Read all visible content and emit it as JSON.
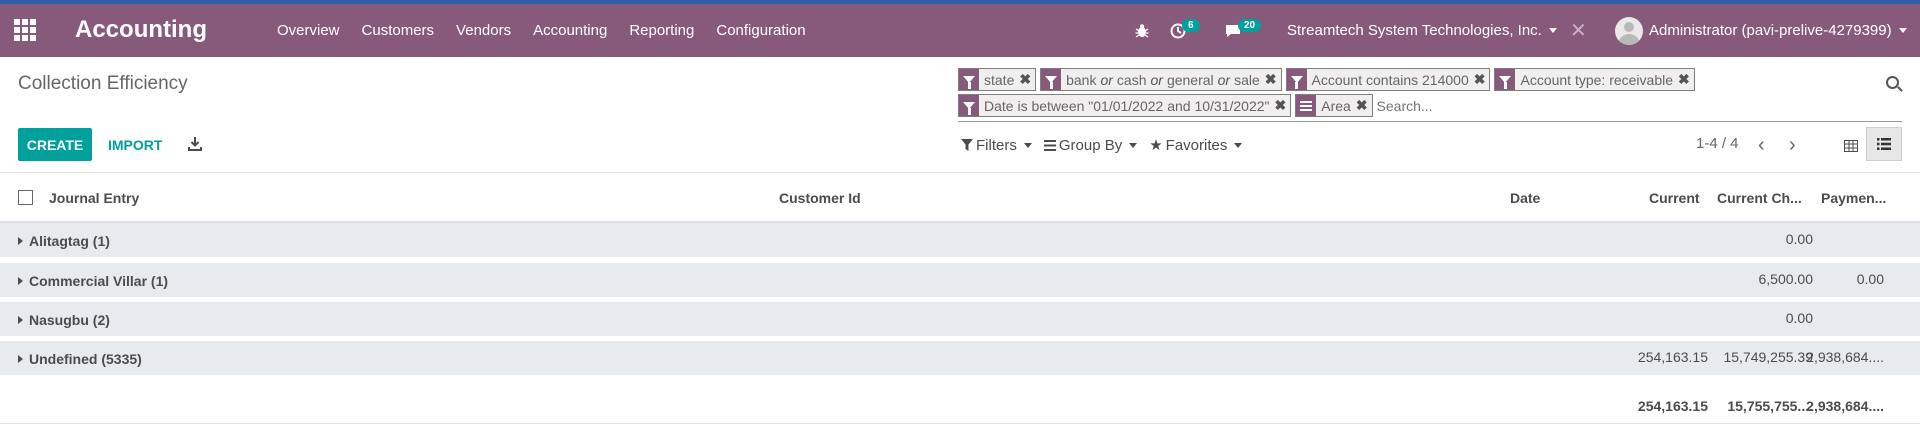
{
  "navbar": {
    "brand": "Accounting",
    "menu": [
      "Overview",
      "Customers",
      "Vendors",
      "Accounting",
      "Reporting",
      "Configuration"
    ],
    "activity_count": "6",
    "message_count": "20",
    "company": "Streamtech System Technologies, Inc.",
    "user": "Administrator (pavi-prelive-4279399)"
  },
  "control_panel": {
    "title": "Collection Efficiency",
    "create_label": "CREATE",
    "import_label": "IMPORT",
    "facets": {
      "state": "state",
      "journal_a": "bank",
      "journal_or": "or",
      "journal_b": "cash",
      "journal_c": "general",
      "journal_d": "sale",
      "account": "Account contains 214000",
      "account_type": "Account type: receivable",
      "date": "Date is between \"01/01/2022 and 10/31/2022\"",
      "group": "Area"
    },
    "search_placeholder": "Search...",
    "filters_label": "Filters",
    "groupby_label": "Group By",
    "favorites_label": "Favorites",
    "pager": "1-4 / 4"
  },
  "list": {
    "columns": {
      "journal_entry": "Journal Entry",
      "customer_id": "Customer Id",
      "date": "Date",
      "current": "Current",
      "current_ch": "Current Ch...",
      "payment": "Paymen..."
    },
    "groups": [
      {
        "name": "Alitagtag (1)",
        "current": "",
        "current_ch": "0.00",
        "payment": ""
      },
      {
        "name": "Commercial Villar (1)",
        "current": "",
        "current_ch": "6,500.00",
        "payment": "0.00"
      },
      {
        "name": "Nasugbu (2)",
        "current": "",
        "current_ch": "0.00",
        "payment": ""
      },
      {
        "name": "Undefined (5335)",
        "current": "254,163.15",
        "current_ch": "15,749,255.39",
        "payment": "2,938,684...."
      }
    ],
    "totals": {
      "current": "254,163.15",
      "current_ch": "15,755,755....",
      "payment": "2,938,684...."
    }
  }
}
